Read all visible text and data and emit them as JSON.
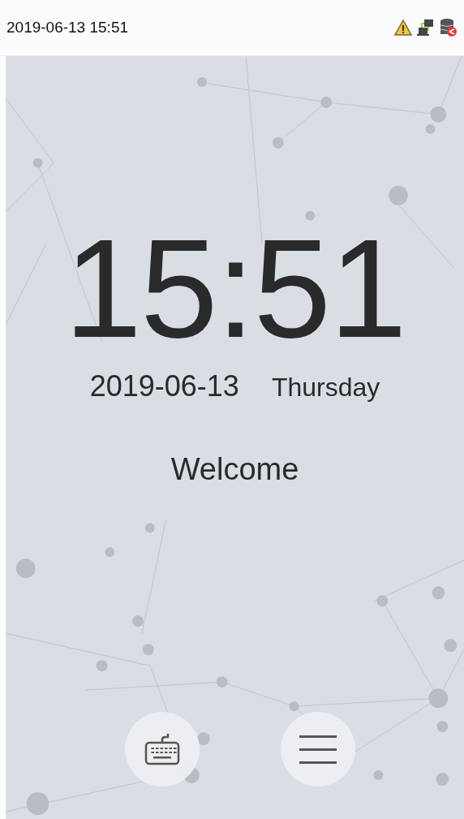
{
  "status_bar": {
    "datetime": "2019-06-13 15:51"
  },
  "clock": {
    "time": "15:51",
    "date": "2019-06-13",
    "weekday": "Thursday"
  },
  "message": "Welcome"
}
